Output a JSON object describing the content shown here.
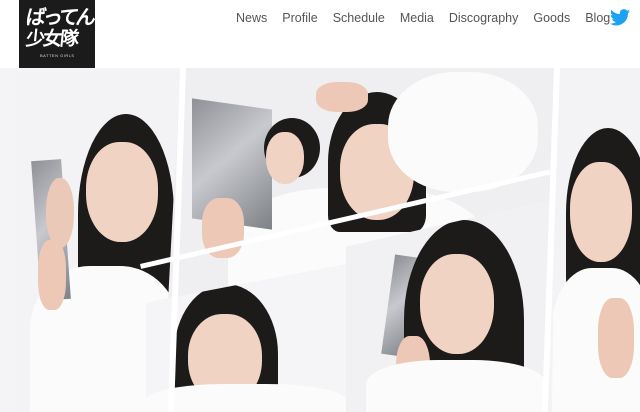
{
  "header": {
    "logo": {
      "line1": "ばってん",
      "line2": "少女隊",
      "sub": "BATTEN GIRLS"
    },
    "nav": {
      "items": [
        {
          "id": "news",
          "label": "News"
        },
        {
          "id": "profile",
          "label": "Profile"
        },
        {
          "id": "schedule",
          "label": "Schedule"
        },
        {
          "id": "media",
          "label": "Media"
        },
        {
          "id": "discography",
          "label": "Discography"
        },
        {
          "id": "goods",
          "label": "Goods"
        },
        {
          "id": "blog",
          "label": "Blog"
        }
      ],
      "social_icon": "twitter-icon"
    }
  },
  "colors": {
    "logo_bg": "#1b1b1b",
    "nav_text": "#555555",
    "twitter_blue": "#1da1f2",
    "hero_bg": "#f4f4f6"
  }
}
